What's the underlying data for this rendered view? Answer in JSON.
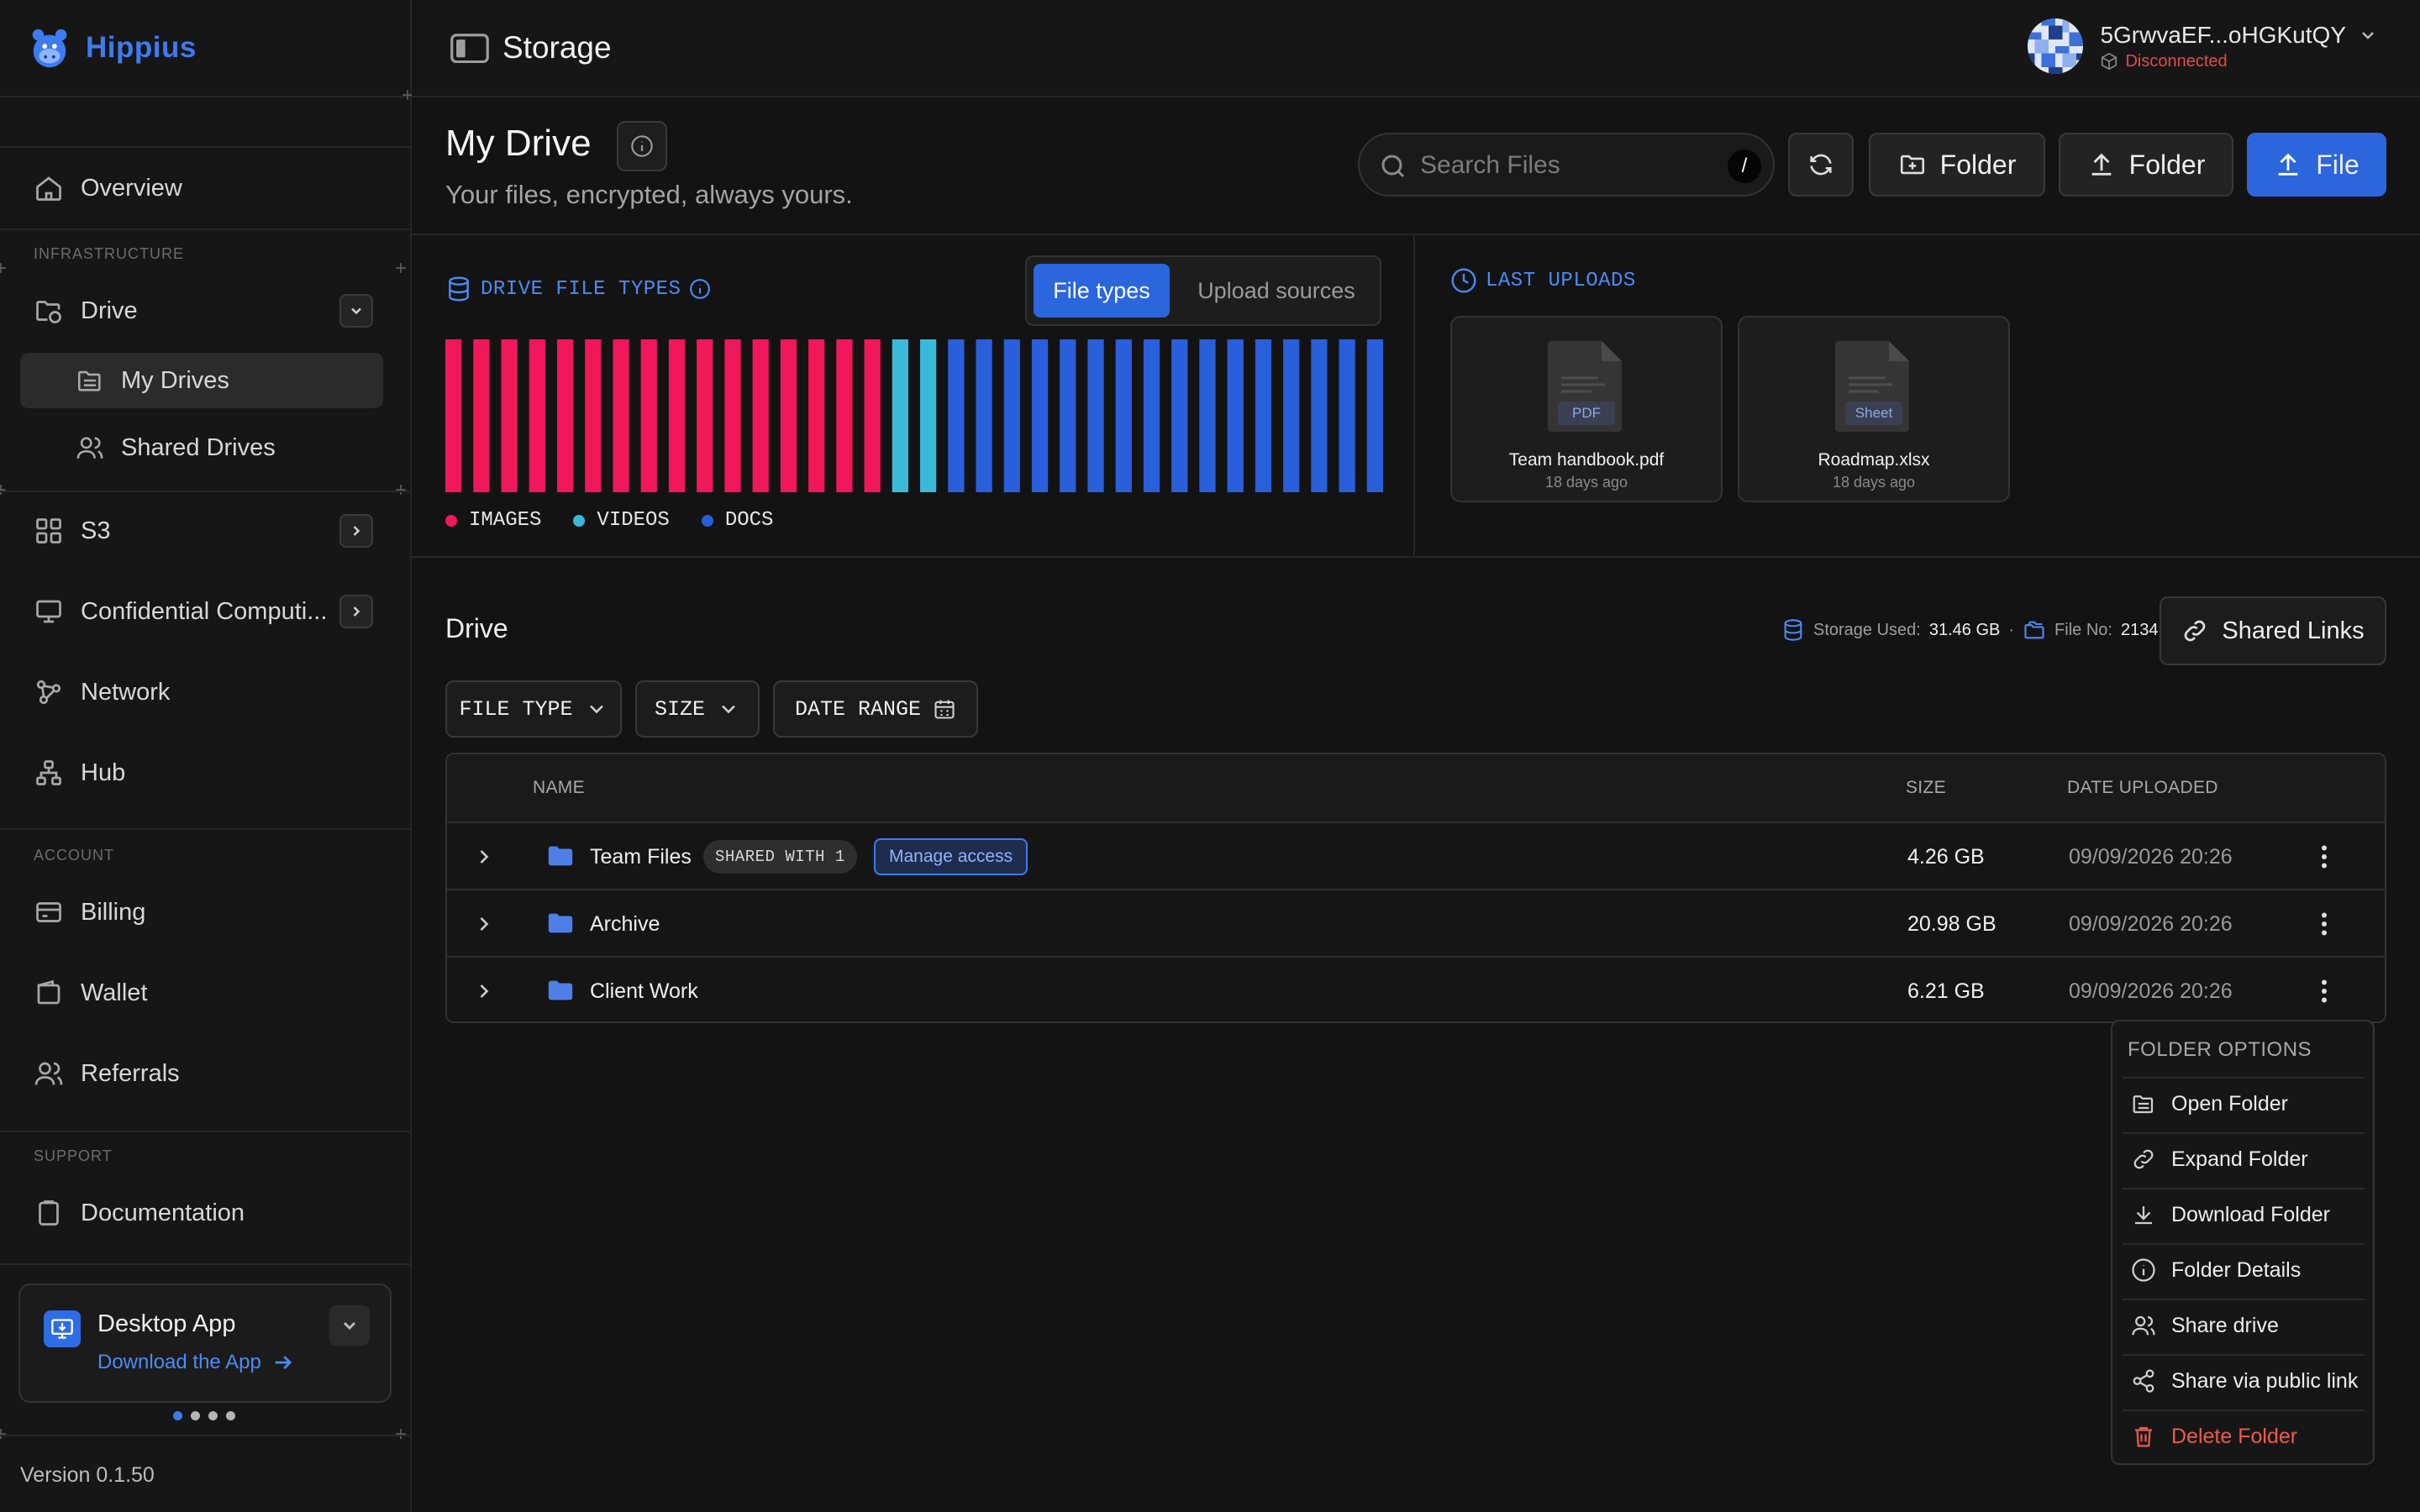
{
  "app": {
    "name": "Hippius",
    "page_title": "Storage",
    "version": "Version 0.1.50"
  },
  "account": {
    "address": "5GrwvaEF...oHGKutQY",
    "status": "Disconnected"
  },
  "sidebar": {
    "overview": "Overview",
    "section_infrastructure": "INFRASTRUCTURE",
    "drive": "Drive",
    "my_drives": "My Drives",
    "shared_drives": "Shared Drives",
    "s3": "S3",
    "confidential": "Confidential Computi...",
    "network": "Network",
    "hub": "Hub",
    "section_account": "ACCOUNT",
    "billing": "Billing",
    "wallet": "Wallet",
    "referrals": "Referrals",
    "section_support": "SUPPORT",
    "documentation": "Documentation",
    "desktop_app": {
      "title": "Desktop App",
      "link": "Download the App"
    }
  },
  "header": {
    "title": "My Drive",
    "subtitle": "Your files, encrypted, always yours.",
    "search_placeholder": "Search Files",
    "search_shortcut": "/",
    "new_folder": "Folder",
    "upload_folder": "Folder",
    "upload_file": "File"
  },
  "file_types": {
    "label": "DRIVE FILE TYPES",
    "tab_active": "File types",
    "tab_other": "Upload sources",
    "legend": [
      {
        "name": "IMAGES",
        "color": "#f0185a"
      },
      {
        "name": "VIDEOS",
        "color": "#3ab9d9"
      },
      {
        "name": "DOCS",
        "color": "#2a5fdc"
      }
    ],
    "bars": [
      "images",
      "images",
      "images",
      "images",
      "images",
      "images",
      "images",
      "images",
      "images",
      "images",
      "images",
      "images",
      "images",
      "images",
      "images",
      "images",
      "videos",
      "videos",
      "docs",
      "docs",
      "docs",
      "docs",
      "docs",
      "docs",
      "docs",
      "docs",
      "docs",
      "docs",
      "docs",
      "docs",
      "docs",
      "docs",
      "docs",
      "docs"
    ]
  },
  "last_uploads": {
    "label": "LAST UPLOADS",
    "items": [
      {
        "name": "Team handbook.pdf",
        "tag": "PDF",
        "date": "18 days ago"
      },
      {
        "name": "Roadmap.xlsx",
        "tag": "Sheet",
        "date": "18 days ago"
      }
    ]
  },
  "drive": {
    "title": "Drive",
    "storage_label": "Storage Used:",
    "storage_value": "31.46 GB",
    "separator": "·",
    "file_no_label": "File No:",
    "file_no_value": "2134",
    "shared_links": "Shared Links",
    "filters": {
      "file_type": "FILE TYPE",
      "size": "SIZE",
      "date_range": "DATE RANGE"
    },
    "columns": {
      "name": "NAME",
      "size": "SIZE",
      "date": "DATE UPLOADED"
    },
    "rows": [
      {
        "name": "Team Files",
        "badge": "SHARED WITH 1",
        "manage": "Manage access",
        "size": "4.26 GB",
        "date": "09/09/2026 20:26"
      },
      {
        "name": "Archive",
        "size": "20.98 GB",
        "date": "09/09/2026 20:26"
      },
      {
        "name": "Client Work",
        "size": "6.21 GB",
        "date": "09/09/2026 20:26"
      }
    ]
  },
  "folder_menu": {
    "title": "FOLDER OPTIONS",
    "items": [
      "Open Folder",
      "Expand Folder",
      "Download Folder",
      "Folder Details",
      "Share drive",
      "Share via public link",
      "Delete Folder"
    ]
  },
  "colors": {
    "accent": "#2b66dd",
    "link": "#4b8bf6",
    "danger": "#ef5a4d",
    "status_disconnected": "#e8484a"
  }
}
